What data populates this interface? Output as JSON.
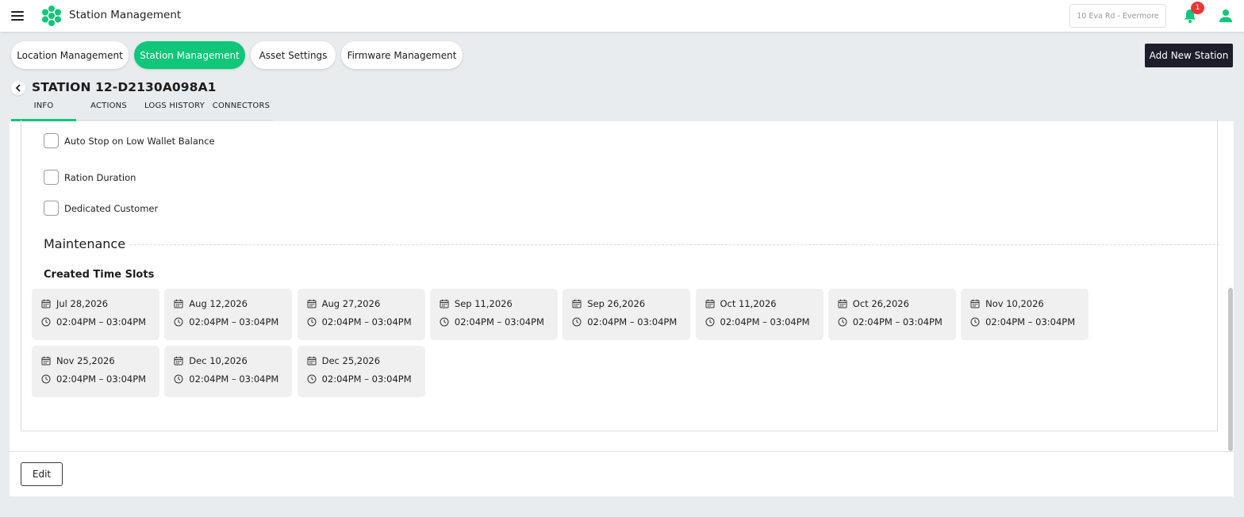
{
  "header": {
    "app_title": "Station Management",
    "location": "10 Eva Rd - Evermore",
    "notification_count": "1"
  },
  "nav": {
    "pills": [
      "Location Management",
      "Station Management",
      "Asset Settings",
      "Firmware Management"
    ],
    "active": "Station Management",
    "add_station": "Add New Station"
  },
  "station": {
    "title": "STATION 12-D2130A098A1",
    "tabs": [
      "INFO",
      "ACTIONS",
      "LOGS HISTORY",
      "CONNECTORS"
    ],
    "active_tab": "INFO"
  },
  "options": {
    "auto_stop": "Auto Stop on Low Wallet Balance",
    "ration_duration": "Ration Duration",
    "dedicated_customer": "Dedicated Customer"
  },
  "maintenance": {
    "title": "Maintenance",
    "created_slots_title": "Created Time Slots",
    "slots": [
      {
        "date": "Jul 28,2026",
        "time": "02:04PM – 03:04PM"
      },
      {
        "date": "Aug 12,2026",
        "time": "02:04PM – 03:04PM"
      },
      {
        "date": "Aug 27,2026",
        "time": "02:04PM – 03:04PM"
      },
      {
        "date": "Sep 11,2026",
        "time": "02:04PM – 03:04PM"
      },
      {
        "date": "Sep 26,2026",
        "time": "02:04PM – 03:04PM"
      },
      {
        "date": "Oct 11,2026",
        "time": "02:04PM – 03:04PM"
      },
      {
        "date": "Oct 26,2026",
        "time": "02:04PM – 03:04PM"
      },
      {
        "date": "Nov 10,2026",
        "time": "02:04PM – 03:04PM"
      },
      {
        "date": "Nov 25,2026",
        "time": "02:04PM – 03:04PM"
      },
      {
        "date": "Dec 10,2026",
        "time": "02:04PM – 03:04PM"
      },
      {
        "date": "Dec 25,2026",
        "time": "02:04PM – 03:04PM"
      }
    ]
  },
  "footer": {
    "edit": "Edit"
  },
  "colors": {
    "accent": "#0ec77a",
    "dark_button": "#1d1d2b",
    "badge": "#e53935",
    "page_bg": "#e9ecef"
  }
}
